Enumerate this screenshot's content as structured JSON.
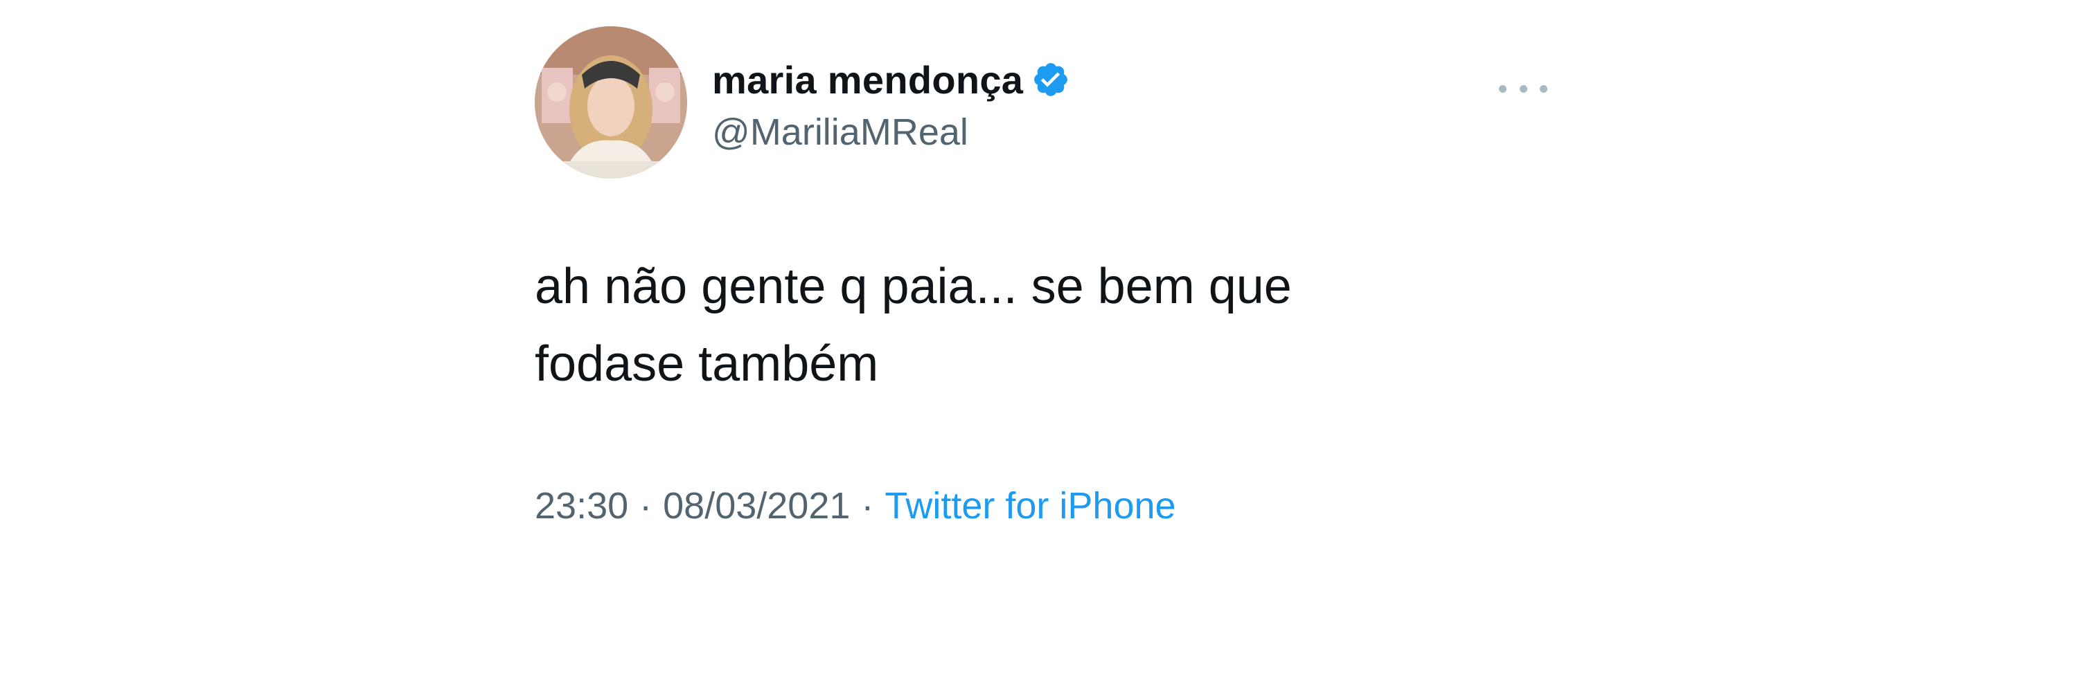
{
  "author": {
    "display_name": "maria mendonça",
    "handle": "@MariliaMReal",
    "verified_icon": "verified-badge-icon",
    "verified_color": "#1d9bf0",
    "avatar_icon": "profile-photo"
  },
  "tweet": {
    "text": "ah não gente q paia... se bem que\nfodase também"
  },
  "meta": {
    "time": "23:30",
    "separator": "·",
    "date": "08/03/2021",
    "source": "Twitter for iPhone"
  },
  "actions": {
    "more_icon": "more-options-icon"
  },
  "colors": {
    "text": "#0f1419",
    "secondary": "#536471",
    "link": "#1d9bf0"
  }
}
